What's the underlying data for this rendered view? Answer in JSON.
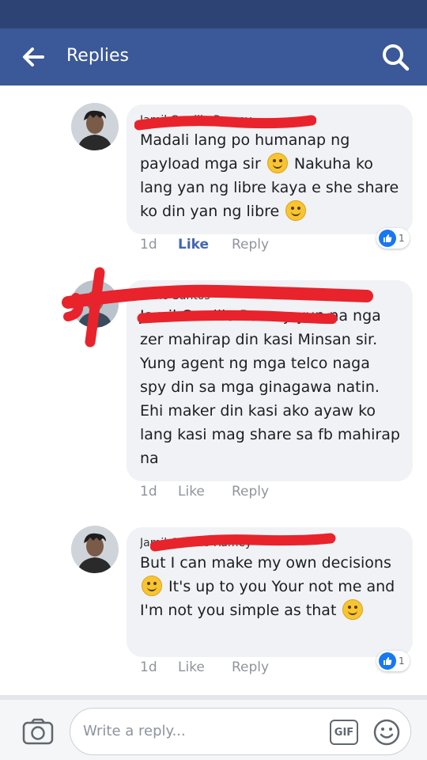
{
  "header": {
    "title": "Replies"
  },
  "comments": [
    {
      "author": "Jamil Carrillo Ramey",
      "text_parts": [
        "Madali lang po humanap ng payload mga sir",
        " Nakuha ko lang yan ng libre kaya e she share ko din yan ng libre",
        ""
      ],
      "time": "1d",
      "like_label": "Like",
      "reply_label": "Reply",
      "reaction_count": "1",
      "liked": true
    },
    {
      "author": "Carlo Santos",
      "text_parts": [
        "Jamil Carrillo Ramey yun na nga zer mahirap din kasi Minsan sir. Yung agent ng mga telco naga spy din sa mga ginagawa natin. Ehi maker din kasi ako ayaw ko lang kasi mag share sa fb mahirap na"
      ],
      "time": "1d",
      "like_label": "Like",
      "reply_label": "Reply",
      "liked": false
    },
    {
      "author": "Jamil Carrillo Ramey",
      "text_parts": [
        "But I can make my own decisions",
        " It's up to you Your not me and I'm not you simple as that",
        ""
      ],
      "time": "1d",
      "like_label": "Like",
      "reply_label": "Reply",
      "reaction_count": "1",
      "liked": false
    }
  ],
  "composer": {
    "placeholder": "Write a reply...",
    "gif_label": "GIF"
  },
  "colors": {
    "brand": "#3b5998",
    "status_bar": "#2d4373",
    "like_blue": "#4267b2",
    "redaction": "#e8232c"
  },
  "icons": [
    "back-arrow-icon",
    "search-icon",
    "camera-icon",
    "emoji-icon",
    "like-thumb-icon",
    "smiley-emoji-icon"
  ]
}
